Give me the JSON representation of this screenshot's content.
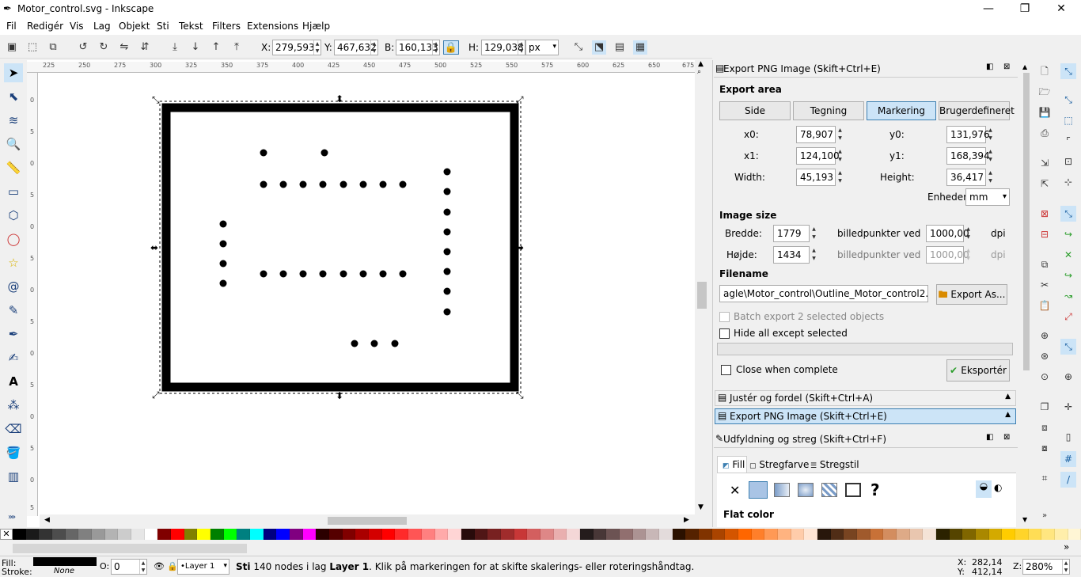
{
  "window": {
    "title": "Motor_control.svg - Inkscape",
    "min": "—",
    "max": "❐",
    "close": "✕"
  },
  "menu": [
    "Fil",
    "Redigér",
    "Vis",
    "Lag",
    "Objekt",
    "Sti",
    "Tekst",
    "Filters",
    "Extensions",
    "Hjælp"
  ],
  "toolbar": {
    "x_label": "X:",
    "x": "279,593",
    "y_label": "Y:",
    "y": "467,632",
    "w_label": "B:",
    "w": "160,133",
    "h_label": "H:",
    "h": "129,038",
    "unit": "px"
  },
  "rulers": {
    "h": [
      "225",
      "250",
      "275",
      "300",
      "325",
      "350",
      "375",
      "400",
      "425",
      "450",
      "475",
      "500",
      "525",
      "550",
      "575",
      "600",
      "625",
      "650",
      "675"
    ],
    "v": [
      "0",
      "5",
      "0",
      "5",
      "0",
      "5",
      "0",
      "5",
      "0",
      "5",
      "0",
      "5",
      "0",
      "5"
    ]
  },
  "export_panel": {
    "header": "Export PNG Image (Skift+Ctrl+E)",
    "export_area_label": "Export area",
    "area_buttons": [
      "Side",
      "Tegning",
      "Markering",
      "Brugerdefineret"
    ],
    "x0_label": "x0:",
    "x0": "78,907",
    "y0_label": "y0:",
    "y0": "131,976",
    "x1_label": "x1:",
    "x1": "124,100",
    "y1_label": "y1:",
    "y1": "168,394",
    "width_label": "Width:",
    "width": "45,193",
    "height_label": "Height:",
    "height": "36,417",
    "units_label": "Enheder:",
    "units": "mm",
    "image_size_label": "Image size",
    "bredde_label": "Bredde:",
    "bredde": "1779",
    "px_at": "billedpunkter ved",
    "dpi1": "1000,00",
    "dpi_label": "dpi",
    "hojde_label": "Højde:",
    "hojde": "1434",
    "dpi2": "1000,00",
    "filename_label": "Filename",
    "filename": "agle\\Motor_control\\Outline_Motor_control2.png",
    "export_as": "Export As...",
    "batch": "Batch export 2 selected objects",
    "hide_all": "Hide all except selected",
    "close_when": "Close when complete",
    "export_btn": "Eksportér"
  },
  "docked": {
    "align": "Justér og fordel (Skift+Ctrl+A)",
    "export": "Export PNG Image (Skift+Ctrl+E)"
  },
  "fill_panel": {
    "header": "Udfyldning og streg (Skift+Ctrl+F)",
    "tabs": [
      "Fill",
      "Stregfarve",
      "Stregstil"
    ],
    "flat_color": "Flat color",
    "unknown": "?"
  },
  "status": {
    "fill_label": "Fill:",
    "stroke_label": "Stroke:",
    "stroke_val": "None",
    "o_label": "O:",
    "o_val": "0",
    "layer": "•Layer 1",
    "message_pre": "Sti",
    "message_mid": " 140 nodes i lag ",
    "message_layer": "Layer 1",
    "message_post": ". Klik på markeringen for at skifte skalerings- eller roteringshåndtag.",
    "x_label": "X:",
    "x": "282,14",
    "y_label": "Y:",
    "y": "412,14",
    "z_label": "Z:",
    "zoom": "280%"
  },
  "colors": {
    "accent": "#3c7fb1",
    "selected_bg": "#cce4f7"
  },
  "palette": [
    "#000000",
    "#1a1a1a",
    "#333333",
    "#4d4d4d",
    "#666666",
    "#808080",
    "#999999",
    "#b3b3b3",
    "#cccccc",
    "#e6e6e6",
    "#ffffff",
    "#800000",
    "#ff0000",
    "#808000",
    "#ffff00",
    "#008000",
    "#00ff00",
    "#008080",
    "#00ffff",
    "#000080",
    "#0000ff",
    "#800080",
    "#ff00ff",
    "#2b0000",
    "#550000",
    "#800000",
    "#aa0000",
    "#d40000",
    "#ff0000",
    "#ff2a2a",
    "#ff5555",
    "#ff8080",
    "#ffaaaa",
    "#ffd5d5",
    "#280b0b",
    "#501616",
    "#782121",
    "#a02c2c",
    "#c83737",
    "#d35f5f",
    "#de8787",
    "#e9afaf",
    "#f4d7d7",
    "#241c1c",
    "#483737",
    "#6c5353",
    "#916f6f",
    "#ac9393",
    "#c8b7b7",
    "#e3dbdb",
    "#2b1100",
    "#552200",
    "#803300",
    "#aa4400",
    "#d45500",
    "#ff6600",
    "#ff7f2a",
    "#ff9955",
    "#ffb380",
    "#ffccaa",
    "#ffe6d5",
    "#28170b",
    "#502d16",
    "#784421",
    "#a05a2c",
    "#c87137",
    "#d38d5f",
    "#deaa87",
    "#e9c6af",
    "#f4e3d7",
    "#2b2200",
    "#554400",
    "#806600",
    "#aa8800",
    "#d4aa00",
    "#ffcc00",
    "#ffd42a",
    "#ffdd55",
    "#ffe680",
    "#ffeeaa",
    "#fff6d5"
  ]
}
